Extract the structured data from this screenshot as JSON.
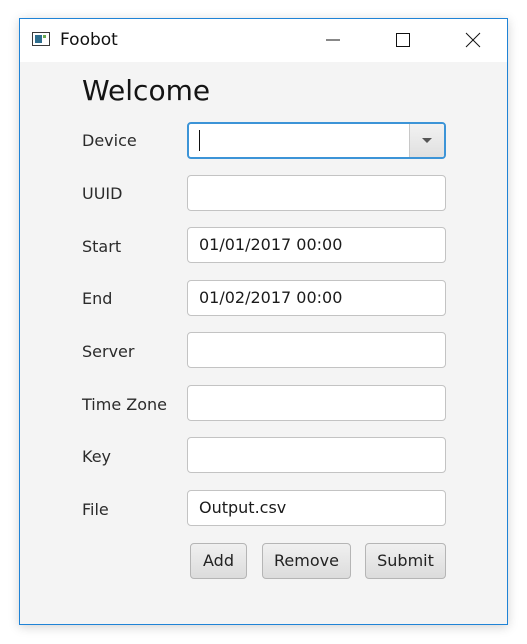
{
  "window": {
    "title": "Foobot"
  },
  "form": {
    "heading": "Welcome",
    "fields": [
      {
        "label": "Device",
        "value": ""
      },
      {
        "label": "UUID",
        "value": ""
      },
      {
        "label": "Start",
        "value": "01/01/2017 00:00"
      },
      {
        "label": "End",
        "value": "01/02/2017 00:00"
      },
      {
        "label": "Server",
        "value": ""
      },
      {
        "label": "Time Zone",
        "value": ""
      },
      {
        "label": "Key",
        "value": ""
      },
      {
        "label": "File",
        "value": "Output.csv"
      }
    ]
  },
  "buttons": {
    "add": "Add",
    "remove": "Remove",
    "submit": "Submit"
  },
  "icons": {
    "app": "app-window-icon",
    "minimize": "minimize-icon",
    "maximize": "maximize-icon",
    "close": "close-icon",
    "dropdown": "chevron-down-icon"
  },
  "colors": {
    "focus_border": "#3c94d7",
    "window_border": "#1f83d6"
  }
}
